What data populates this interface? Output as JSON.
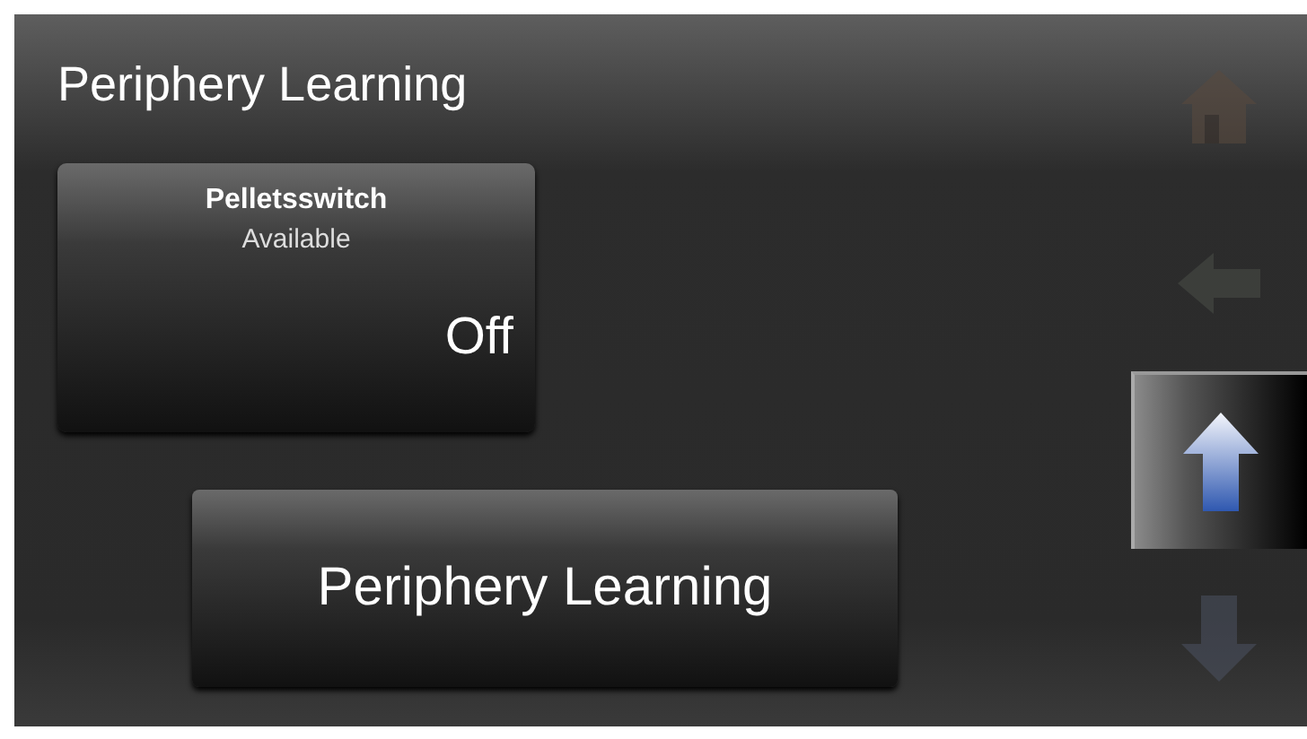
{
  "title": "Periphery Learning",
  "device": {
    "name": "Pelletsswitch",
    "status": "Available",
    "state": "Off"
  },
  "action_button": {
    "label": "Periphery Learning"
  },
  "nav": [
    {
      "kind": "home",
      "disabled": true
    },
    {
      "kind": "back",
      "disabled": true
    },
    {
      "kind": "up",
      "disabled": false
    },
    {
      "kind": "down",
      "disabled": true
    }
  ]
}
